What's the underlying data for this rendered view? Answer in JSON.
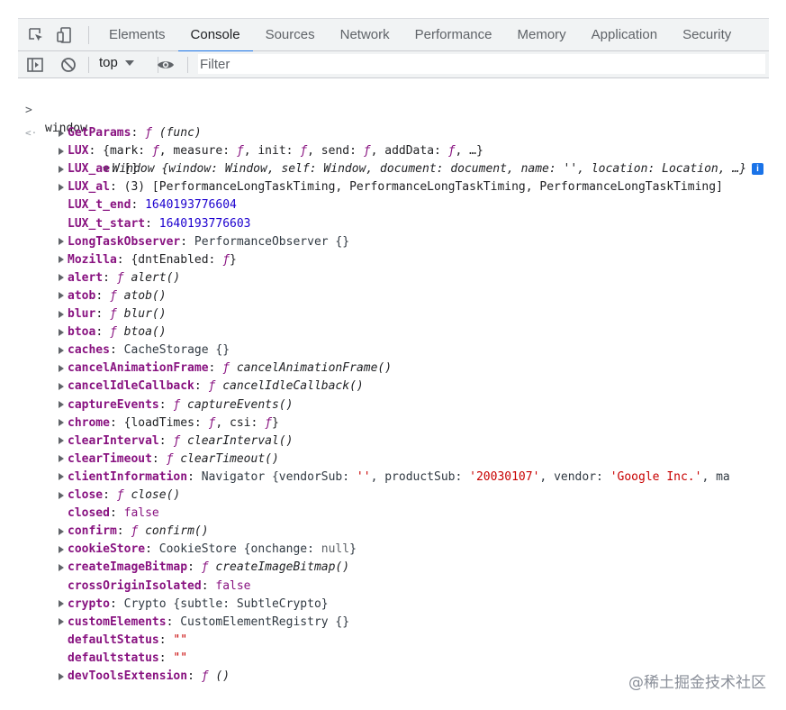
{
  "tabs": [
    {
      "label": "Elements",
      "active": false
    },
    {
      "label": "Console",
      "active": true
    },
    {
      "label": "Sources",
      "active": false
    },
    {
      "label": "Network",
      "active": false
    },
    {
      "label": "Performance",
      "active": false
    },
    {
      "label": "Memory",
      "active": false
    },
    {
      "label": "Application",
      "active": false
    },
    {
      "label": "Security",
      "active": false
    }
  ],
  "toolbar": {
    "context": "top",
    "filter_placeholder": "Filter"
  },
  "icons": {
    "inspect": "inspect-element-icon",
    "device": "device-toggle-icon",
    "sidebar": "sidebar-toggle-icon",
    "clear": "clear-console-icon",
    "dropdown": "chevron-down-icon",
    "eye": "eye-icon",
    "info": "info-icon"
  },
  "colors": {
    "accent": "#1a73e8",
    "property_key": "#881280",
    "number": "#1c00cf",
    "string": "#c80000"
  },
  "console": {
    "input": "window",
    "summary_head": "Window ",
    "summary_body": "{window: Window, self: Window, document: document, name: '', location: Location, …}",
    "entries": [
      {
        "key": "GetParams",
        "expandable": true,
        "segs": [
          {
            "t": "ƒ",
            "c": "f"
          },
          {
            "t": " (func)",
            "c": "it plain"
          }
        ]
      },
      {
        "key": "LUX",
        "expandable": true,
        "segs": [
          {
            "t": "{mark: ",
            "c": "plain"
          },
          {
            "t": "ƒ",
            "c": "f"
          },
          {
            "t": ", measure: ",
            "c": "plain"
          },
          {
            "t": "ƒ",
            "c": "f"
          },
          {
            "t": ", init: ",
            "c": "plain"
          },
          {
            "t": "ƒ",
            "c": "f"
          },
          {
            "t": ", send: ",
            "c": "plain"
          },
          {
            "t": "ƒ",
            "c": "f"
          },
          {
            "t": ", addData: ",
            "c": "plain"
          },
          {
            "t": "ƒ",
            "c": "f"
          },
          {
            "t": ", …}",
            "c": "plain"
          }
        ]
      },
      {
        "key": "LUX_ae",
        "expandable": true,
        "segs": [
          {
            "t": "[]",
            "c": "plain"
          }
        ]
      },
      {
        "key": "LUX_al",
        "expandable": true,
        "segs": [
          {
            "t": "(3) [PerformanceLongTaskTiming, PerformanceLongTaskTiming, PerformanceLongTaskTiming]",
            "c": "plain"
          }
        ]
      },
      {
        "key": "LUX_t_end",
        "expandable": false,
        "segs": [
          {
            "t": "1640193776604",
            "c": "num"
          }
        ]
      },
      {
        "key": "LUX_t_start",
        "expandable": false,
        "segs": [
          {
            "t": "1640193776603",
            "c": "num"
          }
        ]
      },
      {
        "key": "LongTaskObserver",
        "expandable": true,
        "segs": [
          {
            "t": "PerformanceObserver {}",
            "c": "dim"
          }
        ]
      },
      {
        "key": "Mozilla",
        "expandable": true,
        "segs": [
          {
            "t": "{dntEnabled: ",
            "c": "plain"
          },
          {
            "t": "ƒ",
            "c": "f"
          },
          {
            "t": "}",
            "c": "plain"
          }
        ]
      },
      {
        "key": "alert",
        "expandable": true,
        "segs": [
          {
            "t": "ƒ",
            "c": "f"
          },
          {
            "t": " alert()",
            "c": "it plain"
          }
        ]
      },
      {
        "key": "atob",
        "expandable": true,
        "segs": [
          {
            "t": "ƒ",
            "c": "f"
          },
          {
            "t": " atob()",
            "c": "it plain"
          }
        ]
      },
      {
        "key": "blur",
        "expandable": true,
        "segs": [
          {
            "t": "ƒ",
            "c": "f"
          },
          {
            "t": " blur()",
            "c": "it plain"
          }
        ]
      },
      {
        "key": "btoa",
        "expandable": true,
        "segs": [
          {
            "t": "ƒ",
            "c": "f"
          },
          {
            "t": " btoa()",
            "c": "it plain"
          }
        ]
      },
      {
        "key": "caches",
        "expandable": true,
        "segs": [
          {
            "t": "CacheStorage {}",
            "c": "dim"
          }
        ]
      },
      {
        "key": "cancelAnimationFrame",
        "expandable": true,
        "segs": [
          {
            "t": "ƒ",
            "c": "f"
          },
          {
            "t": " cancelAnimationFrame()",
            "c": "it plain"
          }
        ]
      },
      {
        "key": "cancelIdleCallback",
        "expandable": true,
        "segs": [
          {
            "t": "ƒ",
            "c": "f"
          },
          {
            "t": " cancelIdleCallback()",
            "c": "it plain"
          }
        ]
      },
      {
        "key": "captureEvents",
        "expandable": true,
        "segs": [
          {
            "t": "ƒ",
            "c": "f"
          },
          {
            "t": " captureEvents()",
            "c": "it plain"
          }
        ]
      },
      {
        "key": "chrome",
        "expandable": true,
        "segs": [
          {
            "t": "{loadTimes: ",
            "c": "plain"
          },
          {
            "t": "ƒ",
            "c": "f"
          },
          {
            "t": ", csi: ",
            "c": "plain"
          },
          {
            "t": "ƒ",
            "c": "f"
          },
          {
            "t": "}",
            "c": "plain"
          }
        ]
      },
      {
        "key": "clearInterval",
        "expandable": true,
        "segs": [
          {
            "t": "ƒ",
            "c": "f"
          },
          {
            "t": " clearInterval()",
            "c": "it plain"
          }
        ]
      },
      {
        "key": "clearTimeout",
        "expandable": true,
        "segs": [
          {
            "t": "ƒ",
            "c": "f"
          },
          {
            "t": " clearTimeout()",
            "c": "it plain"
          }
        ]
      },
      {
        "key": "clientInformation",
        "expandable": true,
        "segs": [
          {
            "t": "Navigator {vendorSub: ",
            "c": "dim"
          },
          {
            "t": "''",
            "c": "str"
          },
          {
            "t": ", productSub: ",
            "c": "dim"
          },
          {
            "t": "'20030107'",
            "c": "str"
          },
          {
            "t": ", vendor: ",
            "c": "dim"
          },
          {
            "t": "'Google Inc.'",
            "c": "str"
          },
          {
            "t": ", ma",
            "c": "dim"
          }
        ]
      },
      {
        "key": "close",
        "expandable": true,
        "segs": [
          {
            "t": "ƒ",
            "c": "f"
          },
          {
            "t": " close()",
            "c": "it plain"
          }
        ]
      },
      {
        "key": "closed",
        "expandable": false,
        "segs": [
          {
            "t": "false",
            "c": "kw"
          }
        ]
      },
      {
        "key": "confirm",
        "expandable": true,
        "segs": [
          {
            "t": "ƒ",
            "c": "f"
          },
          {
            "t": " confirm()",
            "c": "it plain"
          }
        ]
      },
      {
        "key": "cookieStore",
        "expandable": true,
        "segs": [
          {
            "t": "CookieStore {onchange: ",
            "c": "dim"
          },
          {
            "t": "null",
            "c": "gray"
          },
          {
            "t": "}",
            "c": "dim"
          }
        ]
      },
      {
        "key": "createImageBitmap",
        "expandable": true,
        "segs": [
          {
            "t": "ƒ",
            "c": "f"
          },
          {
            "t": " createImageBitmap()",
            "c": "it plain"
          }
        ]
      },
      {
        "key": "crossOriginIsolated",
        "expandable": false,
        "segs": [
          {
            "t": "false",
            "c": "kw"
          }
        ]
      },
      {
        "key": "crypto",
        "expandable": true,
        "segs": [
          {
            "t": "Crypto {subtle: SubtleCrypto}",
            "c": "dim"
          }
        ]
      },
      {
        "key": "customElements",
        "expandable": true,
        "segs": [
          {
            "t": "CustomElementRegistry {}",
            "c": "dim"
          }
        ]
      },
      {
        "key": "defaultStatus",
        "expandable": false,
        "segs": [
          {
            "t": "\"\"",
            "c": "str"
          }
        ]
      },
      {
        "key": "defaultstatus",
        "expandable": false,
        "segs": [
          {
            "t": "\"\"",
            "c": "str"
          }
        ]
      },
      {
        "key": "devToolsExtension",
        "expandable": true,
        "segs": [
          {
            "t": "ƒ",
            "c": "f"
          },
          {
            "t": " ()",
            "c": "it plain"
          }
        ]
      }
    ]
  },
  "watermark": "@稀土掘金技术社区"
}
